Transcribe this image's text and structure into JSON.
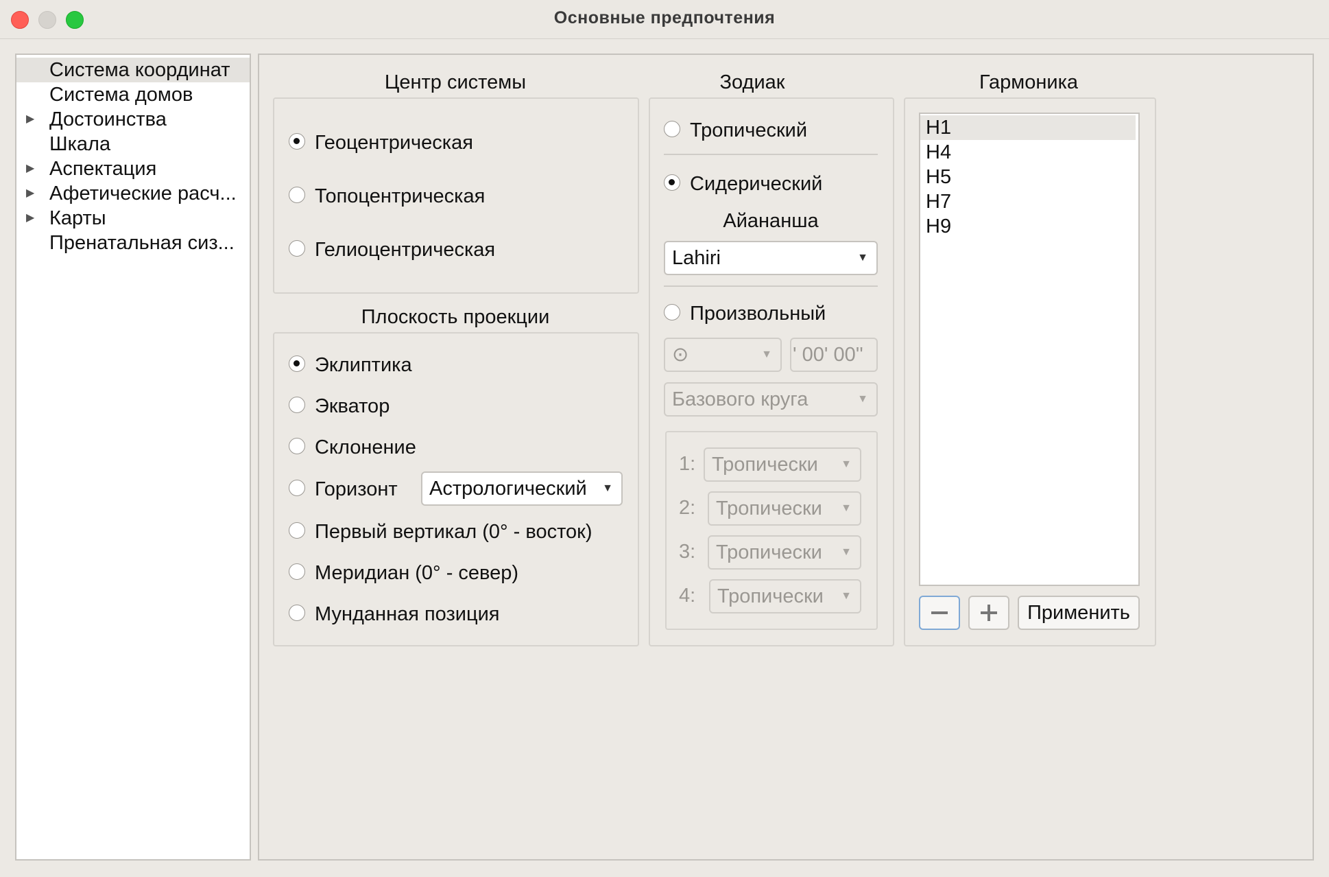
{
  "window": {
    "title": "Основные предпочтения"
  },
  "sidebar": {
    "items": [
      {
        "label": "Система координат",
        "expandable": false,
        "selected": true
      },
      {
        "label": "Система домов",
        "expandable": false
      },
      {
        "label": "Достоинства",
        "expandable": true
      },
      {
        "label": "Шкала",
        "expandable": false
      },
      {
        "label": "Аспектация",
        "expandable": true
      },
      {
        "label": "Афетические расч...",
        "expandable": true
      },
      {
        "label": "Карты",
        "expandable": true
      },
      {
        "label": "Пренатальная сиз...",
        "expandable": false
      }
    ]
  },
  "center": {
    "title": "Центр системы",
    "options": [
      "Геоцентрическая",
      "Топоцентрическая",
      "Гелиоцентрическая"
    ],
    "selected_index": 0
  },
  "projection": {
    "title": "Плоскость проекции",
    "options": [
      "Эклиптика",
      "Экватор",
      "Склонение",
      "Горизонт",
      "Первый вертикал (0° - восток)",
      "Меридиан (0° - север)",
      "Мунданная позиция"
    ],
    "selected_index": 0,
    "horizon_combo": "Астрологический"
  },
  "zodiac": {
    "title": "Зодиак",
    "tropical": "Тропический",
    "sidereal": "Сидерический",
    "selected": "sidereal",
    "ayanamsha_label": "Айананша",
    "ayanamsha_value": "Lahiri",
    "arbitrary": "Произвольный",
    "planet_symbol": "⊙",
    "offset": "' 00' 00''",
    "circle": "Базового круга",
    "rows": [
      {
        "num": "1:",
        "value": "Тропически"
      },
      {
        "num": "2:",
        "value": "Тропически"
      },
      {
        "num": "3:",
        "value": "Тропически"
      },
      {
        "num": "4:",
        "value": "Тропически"
      }
    ]
  },
  "harmonics": {
    "title": "Гармоника",
    "items": [
      "H1",
      "H4",
      "H5",
      "H7",
      "H9"
    ],
    "selected_index": 0,
    "apply_label": "Применить",
    "minus_icon": "minus-icon",
    "plus_icon": "plus-icon"
  }
}
